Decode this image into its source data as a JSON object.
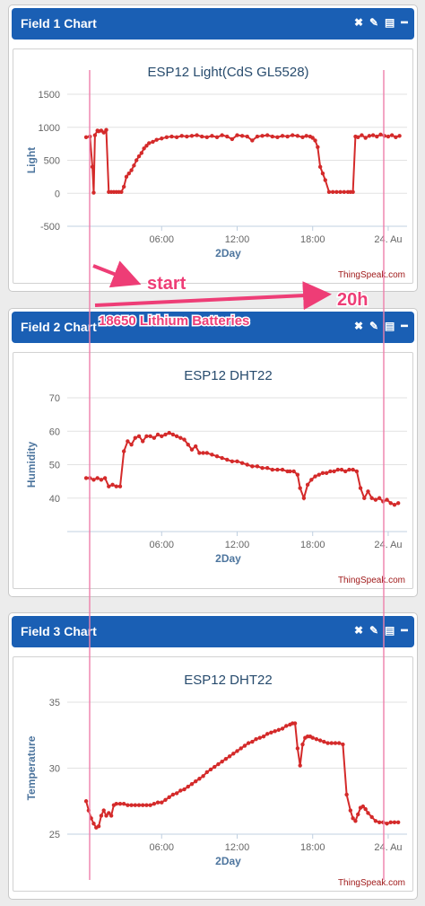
{
  "colors": {
    "header": "#1a5fb4",
    "series": "#d42a2a",
    "annotation": "#ee3d76",
    "title": "#274b6d",
    "credit": "#a01b1b"
  },
  "header_icons": [
    "close-icon",
    "edit-icon",
    "comment-icon",
    "minimize-icon"
  ],
  "icon_glyphs": {
    "close": "✖",
    "edit": "✎",
    "comment": "▤",
    "minimize": "━"
  },
  "panels": [
    {
      "header_title": "Field 1 Chart"
    },
    {
      "header_title": "Field 2 Chart"
    },
    {
      "header_title": "Field 3 Chart"
    }
  ],
  "annotations": {
    "start_label": "start",
    "duration_label": "20h",
    "battery_label": "18650  Lithium Batteries"
  },
  "chart_data": [
    {
      "type": "line",
      "title": "ESP12 Light(CdS GL5528)",
      "xlabel": "2Day",
      "ylabel": "Light",
      "credit": "ThingSpeak.com",
      "x_unit": "hours",
      "xlim": [
        -1.5,
        25.5
      ],
      "ylim": [
        -500,
        1500
      ],
      "yticks": [
        -500,
        0,
        500,
        1000,
        1500
      ],
      "xticks": [
        {
          "value": 6,
          "label": "06:00"
        },
        {
          "value": 12,
          "label": "12:00"
        },
        {
          "value": 18,
          "label": "18:00"
        },
        {
          "value": 24,
          "label": "24. Au"
        }
      ],
      "grid": true,
      "series": [
        {
          "x": [
            0.0,
            0.3,
            0.5,
            0.6,
            0.7,
            0.9,
            1.0,
            1.2,
            1.4,
            1.6,
            1.8,
            2.0,
            2.2,
            2.4,
            2.6,
            2.8,
            3.0,
            3.2,
            3.4,
            3.6,
            3.8,
            4.0,
            4.2,
            4.4,
            4.6,
            4.8,
            5.0,
            5.3,
            5.6,
            6.0,
            6.4,
            6.8,
            7.2,
            7.6,
            8.0,
            8.4,
            8.8,
            9.2,
            9.6,
            10.0,
            10.4,
            10.8,
            11.2,
            11.6,
            12.0,
            12.4,
            12.8,
            13.2,
            13.6,
            14.0,
            14.4,
            14.8,
            15.2,
            15.6,
            16.0,
            16.4,
            16.8,
            17.2,
            17.5,
            17.8,
            18.0,
            18.2,
            18.4,
            18.6,
            18.8,
            19.0,
            19.3,
            19.6,
            19.9,
            20.2,
            20.5,
            20.8,
            21.0,
            21.2,
            21.4,
            21.6,
            21.9,
            22.2,
            22.5,
            22.8,
            23.1,
            23.4,
            23.7,
            24.0,
            24.3,
            24.6,
            24.9
          ],
          "values": [
            850,
            860,
            400,
            10,
            880,
            950,
            940,
            950,
            920,
            960,
            20,
            20,
            20,
            20,
            20,
            20,
            100,
            250,
            300,
            350,
            420,
            500,
            560,
            610,
            680,
            720,
            760,
            780,
            810,
            830,
            850,
            860,
            850,
            870,
            860,
            870,
            880,
            860,
            850,
            870,
            850,
            880,
            860,
            820,
            880,
            870,
            860,
            800,
            860,
            870,
            880,
            860,
            850,
            870,
            860,
            880,
            870,
            850,
            870,
            860,
            840,
            800,
            700,
            400,
            300,
            200,
            20,
            20,
            20,
            20,
            20,
            20,
            20,
            20,
            860,
            850,
            880,
            840,
            870,
            880,
            860,
            890,
            870,
            860,
            880,
            850,
            870
          ]
        }
      ]
    },
    {
      "type": "line",
      "title": "ESP12 DHT22",
      "xlabel": "2Day",
      "ylabel": "Humidity",
      "credit": "ThingSpeak.com",
      "x_unit": "hours",
      "xlim": [
        -1.5,
        25.5
      ],
      "ylim": [
        30,
        70
      ],
      "yticks": [
        40,
        50,
        60,
        70
      ],
      "xticks": [
        {
          "value": 6,
          "label": "06:00"
        },
        {
          "value": 12,
          "label": "12:00"
        },
        {
          "value": 18,
          "label": "18:00"
        },
        {
          "value": 24,
          "label": "24. Au"
        }
      ],
      "grid": true,
      "series": [
        {
          "x": [
            0.0,
            0.3,
            0.6,
            0.9,
            1.2,
            1.5,
            1.8,
            2.1,
            2.4,
            2.7,
            3.0,
            3.3,
            3.6,
            3.9,
            4.2,
            4.5,
            4.8,
            5.1,
            5.4,
            5.7,
            6.0,
            6.3,
            6.6,
            6.9,
            7.2,
            7.5,
            7.8,
            8.1,
            8.4,
            8.7,
            9.0,
            9.3,
            9.6,
            10.0,
            10.4,
            10.8,
            11.2,
            11.6,
            12.0,
            12.4,
            12.8,
            13.2,
            13.6,
            14.0,
            14.4,
            14.8,
            15.2,
            15.6,
            16.0,
            16.2,
            16.5,
            16.8,
            17.0,
            17.3,
            17.6,
            17.9,
            18.2,
            18.5,
            18.8,
            19.1,
            19.4,
            19.7,
            20.0,
            20.3,
            20.6,
            20.9,
            21.2,
            21.5,
            21.8,
            22.1,
            22.4,
            22.7,
            23.0,
            23.3,
            23.6,
            23.9,
            24.2,
            24.5,
            24.8
          ],
          "values": [
            46,
            46,
            45.5,
            46,
            45.5,
            46,
            43.5,
            44,
            43.5,
            43.5,
            54,
            57,
            56,
            58,
            58.5,
            57,
            58.5,
            58.5,
            58,
            59,
            58.5,
            59,
            59.5,
            59,
            58.5,
            58,
            57.5,
            56,
            54.5,
            55.5,
            53.5,
            53.5,
            53.5,
            53,
            52.5,
            52,
            51.5,
            51,
            51,
            50.5,
            50,
            49.5,
            49.5,
            49,
            49,
            48.5,
            48.5,
            48.5,
            48,
            48,
            48,
            47,
            43,
            40,
            44,
            45.5,
            46.5,
            47,
            47.5,
            47.5,
            48,
            48,
            48.5,
            48.5,
            48,
            48.5,
            48.5,
            48,
            43,
            40,
            42,
            40,
            39.5,
            40,
            39,
            39.5,
            38.5,
            38,
            38.5
          ]
        }
      ]
    },
    {
      "type": "line",
      "title": "ESP12 DHT22",
      "xlabel": "2Day",
      "ylabel": "Temperature",
      "credit": "ThingSpeak.com",
      "x_unit": "hours",
      "xlim": [
        -1.5,
        25.5
      ],
      "ylim": [
        25,
        35
      ],
      "yticks": [
        25,
        30,
        35
      ],
      "xticks": [
        {
          "value": 6,
          "label": "06:00"
        },
        {
          "value": 12,
          "label": "12:00"
        },
        {
          "value": 18,
          "label": "18:00"
        },
        {
          "value": 24,
          "label": "24. Au"
        }
      ],
      "grid": true,
      "series": [
        {
          "x": [
            0.0,
            0.2,
            0.4,
            0.6,
            0.8,
            1.0,
            1.2,
            1.4,
            1.6,
            1.8,
            2.0,
            2.2,
            2.4,
            2.7,
            3.0,
            3.3,
            3.6,
            3.9,
            4.2,
            4.5,
            4.8,
            5.1,
            5.4,
            5.7,
            6.0,
            6.3,
            6.6,
            6.9,
            7.2,
            7.5,
            7.8,
            8.1,
            8.4,
            8.7,
            9.0,
            9.3,
            9.6,
            9.9,
            10.2,
            10.5,
            10.8,
            11.1,
            11.4,
            11.7,
            12.0,
            12.3,
            12.6,
            12.9,
            13.2,
            13.5,
            13.8,
            14.1,
            14.4,
            14.7,
            15.0,
            15.3,
            15.6,
            15.9,
            16.2,
            16.4,
            16.6,
            16.8,
            17.0,
            17.2,
            17.4,
            17.6,
            17.8,
            18.0,
            18.3,
            18.6,
            18.9,
            19.2,
            19.5,
            19.8,
            20.1,
            20.4,
            20.7,
            21.0,
            21.2,
            21.4,
            21.6,
            21.8,
            22.0,
            22.2,
            22.4,
            22.7,
            23.0,
            23.3,
            23.6,
            23.9,
            24.2,
            24.5,
            24.8
          ],
          "values": [
            27.5,
            26.8,
            26.2,
            25.8,
            25.5,
            25.6,
            26.4,
            26.8,
            26.4,
            26.6,
            26.4,
            27.2,
            27.3,
            27.3,
            27.3,
            27.2,
            27.2,
            27.2,
            27.2,
            27.2,
            27.2,
            27.2,
            27.3,
            27.4,
            27.4,
            27.6,
            27.8,
            28.0,
            28.1,
            28.3,
            28.4,
            28.6,
            28.8,
            29.0,
            29.2,
            29.4,
            29.7,
            29.9,
            30.1,
            30.3,
            30.5,
            30.7,
            30.9,
            31.1,
            31.3,
            31.5,
            31.7,
            31.9,
            32.0,
            32.2,
            32.3,
            32.4,
            32.6,
            32.7,
            32.8,
            32.9,
            33.0,
            33.2,
            33.3,
            33.4,
            33.4,
            31.5,
            30.2,
            31.8,
            32.3,
            32.4,
            32.4,
            32.3,
            32.2,
            32.1,
            32.0,
            31.9,
            31.9,
            31.9,
            31.9,
            31.8,
            28.0,
            26.8,
            26.2,
            26.0,
            26.5,
            27.0,
            27.1,
            26.9,
            26.6,
            26.3,
            26.0,
            25.9,
            25.9,
            25.8,
            25.9,
            25.9,
            25.9
          ]
        }
      ]
    }
  ]
}
